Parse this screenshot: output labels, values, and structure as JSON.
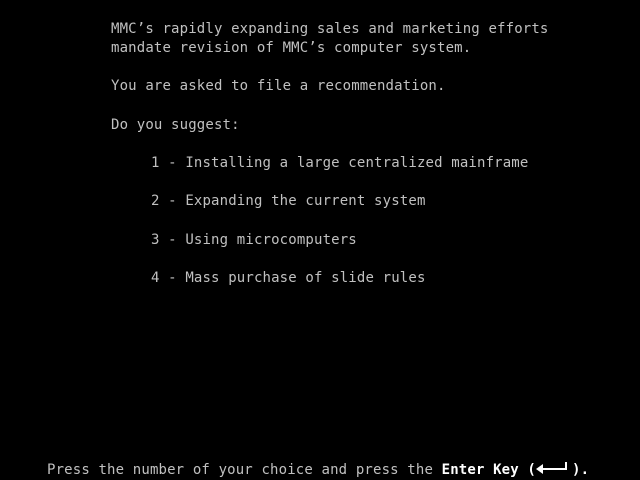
{
  "screen": {
    "background_color": "#000000",
    "text_color": "#c0c0c0",
    "highlight_color": "#ffffff"
  },
  "intro": {
    "line1": "MMC’s rapidly expanding sales and marketing efforts",
    "line2": "mandate revision of MMC’s computer system.",
    "line3": "You are asked to file a recommendation.",
    "question": "Do you suggest:"
  },
  "options": [
    {
      "text": "1 - Installing a large centralized mainframe"
    },
    {
      "text": "2 - Expanding the current system"
    },
    {
      "text": "3 - Using microcomputers"
    },
    {
      "text": "4 - Mass purchase of slide rules"
    }
  ],
  "prompt": {
    "prefix": "Press the number of your choice and press the ",
    "key_label": "Enter Key",
    "open_paren": " (",
    "key_icon": "enter-arrow-icon",
    "suffix": ")."
  }
}
